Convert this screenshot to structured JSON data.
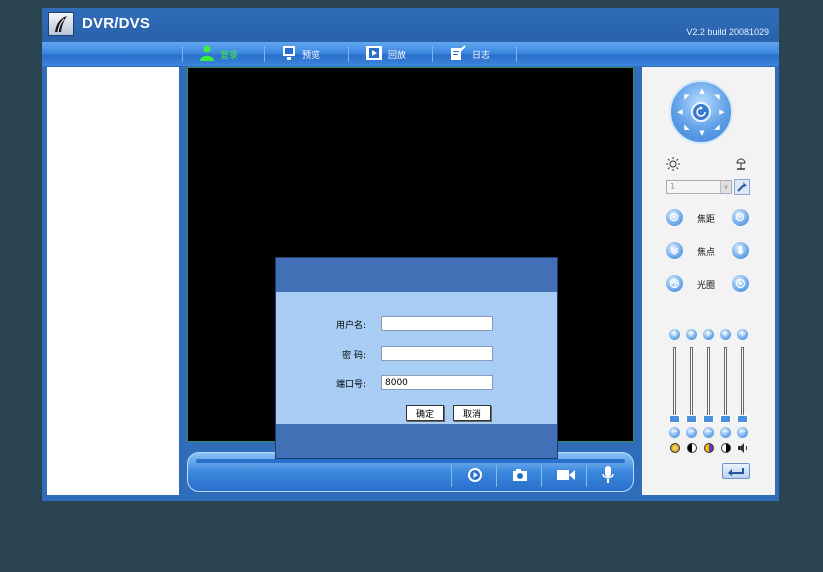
{
  "app": {
    "title": "DVR/DVS",
    "version": "V2.2  build 20081029"
  },
  "nav": [
    {
      "label": "登录",
      "icon": "user-icon",
      "active": true
    },
    {
      "label": "预览",
      "icon": "monitor-icon",
      "active": false
    },
    {
      "label": "回放",
      "icon": "film-icon",
      "active": false
    },
    {
      "label": "日志",
      "icon": "log-icon",
      "active": false
    }
  ],
  "login": {
    "username_label": "用户名:",
    "username_value": "",
    "password_label": "密  码:",
    "password_value": "",
    "port_label": "端口号:",
    "port_value": "8000",
    "ok_label": "确定",
    "cancel_label": "取消"
  },
  "ptz": {
    "preset_value": "1",
    "zoom_label": "焦距",
    "focus_label": "焦点",
    "iris_label": "光圈"
  },
  "colors": {
    "accent": "#2f6cb9",
    "active_nav": "#3af03a",
    "dialog_header": "#4170b6",
    "dialog_body": "#a9cdf5"
  }
}
